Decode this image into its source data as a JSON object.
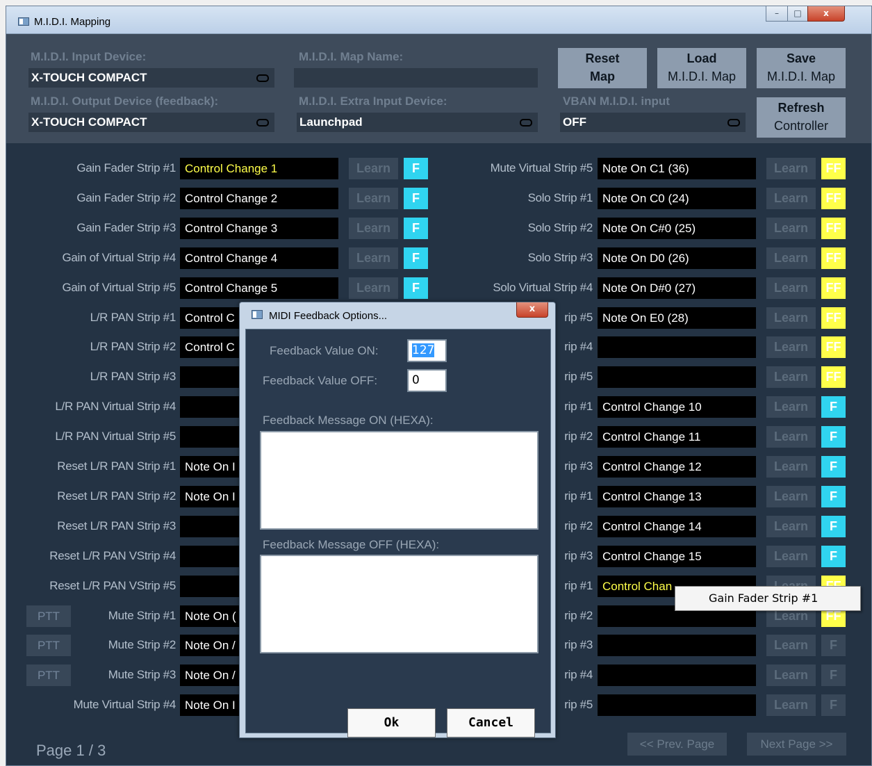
{
  "window": {
    "title": "M.I.D.I. Mapping",
    "minimize": "–",
    "maximize": "□",
    "close": "x"
  },
  "header": {
    "input_device_label": "M.I.D.I. Input Device:",
    "input_device_value": "X-TOUCH COMPACT",
    "map_name_label": "M.I.D.I. Map Name:",
    "map_name_value": "",
    "output_device_label": "M.I.D.I. Output Device (feedback):",
    "output_device_value": "X-TOUCH COMPACT",
    "extra_input_label": "M.I.D.I. Extra Input Device:",
    "extra_input_value": "Launchpad",
    "vban_label": "VBAN M.I.D.I. input",
    "vban_value": "OFF",
    "reset_map": {
      "line1": "Reset",
      "line2": "Map"
    },
    "load_map": {
      "line1": "Load",
      "line2": "M.I.D.I. Map"
    },
    "save_map": {
      "line1": "Save",
      "line2": "M.I.D.I. Map"
    },
    "refresh": {
      "line1": "Refresh",
      "line2": "Controller"
    }
  },
  "left_rows": [
    {
      "label": "Gain Fader Strip #1",
      "value": "Control Change 1",
      "highlight": true,
      "learn": "Learn",
      "f": "F",
      "f_state": "on"
    },
    {
      "label": "Gain Fader Strip #2",
      "value": "Control Change 2",
      "learn": "Learn",
      "f": "F",
      "f_state": "on"
    },
    {
      "label": "Gain Fader Strip #3",
      "value": "Control Change 3",
      "learn": "Learn",
      "f": "F",
      "f_state": "on"
    },
    {
      "label": "Gain of Virtual Strip #4",
      "value": "Control Change 4",
      "learn": "Learn",
      "f": "F",
      "f_state": "on"
    },
    {
      "label": "Gain of Virtual Strip #5",
      "value": "Control Change 5",
      "learn": "Learn",
      "f": "F",
      "f_state": "on"
    },
    {
      "label": "L/R PAN Strip #1",
      "value": "Control C"
    },
    {
      "label": "L/R PAN Strip #2",
      "value": "Control C"
    },
    {
      "label": "L/R PAN Strip #3",
      "value": ""
    },
    {
      "label": "L/R PAN Virtual Strip #4",
      "value": ""
    },
    {
      "label": "L/R PAN Virtual Strip #5",
      "value": ""
    },
    {
      "label": "Reset L/R PAN Strip #1",
      "value": "Note On I"
    },
    {
      "label": "Reset L/R PAN Strip #2",
      "value": "Note On I"
    },
    {
      "label": "Reset L/R PAN Strip #3",
      "value": ""
    },
    {
      "label": "Reset L/R PAN VStrip #4",
      "value": ""
    },
    {
      "label": "Reset L/R PAN VStrip #5",
      "value": ""
    },
    {
      "label": "Mute Strip #1",
      "value": "Note On (",
      "ptt": "PTT"
    },
    {
      "label": "Mute Strip #2",
      "value": "Note On /",
      "ptt": "PTT"
    },
    {
      "label": "Mute Strip #3",
      "value": "Note On /",
      "ptt": "PTT"
    },
    {
      "label": "Mute Virtual Strip #4",
      "value": "Note On I"
    }
  ],
  "right_rows": [
    {
      "label": "Mute Virtual Strip #5",
      "value": "Note On C1 (36)",
      "learn": "Learn",
      "f": "FF",
      "f_state": "ff"
    },
    {
      "label": "Solo Strip #1",
      "value": "Note On C0 (24)",
      "learn": "Learn",
      "f": "FF",
      "f_state": "ff"
    },
    {
      "label": "Solo Strip #2",
      "value": "Note On C#0 (25)",
      "learn": "Learn",
      "f": "FF",
      "f_state": "ff"
    },
    {
      "label": "Solo Strip #3",
      "value": "Note On D0 (26)",
      "learn": "Learn",
      "f": "FF",
      "f_state": "ff"
    },
    {
      "label": "Solo Virtual Strip #4",
      "value": "Note On D#0 (27)",
      "learn": "Learn",
      "f": "FF",
      "f_state": "ff"
    },
    {
      "label": "rip #5",
      "value": "Note On E0 (28)",
      "learn": "Learn",
      "f": "FF",
      "f_state": "ff"
    },
    {
      "label": "rip #4",
      "value": "",
      "learn": "Learn",
      "f": "FF",
      "f_state": "ff"
    },
    {
      "label": "rip #5",
      "value": "",
      "learn": "Learn",
      "f": "FF",
      "f_state": "ff"
    },
    {
      "label": "rip #1",
      "value": "Control Change 10",
      "learn": "Learn",
      "f": "F",
      "f_state": "on"
    },
    {
      "label": "rip #2",
      "value": "Control Change 11",
      "learn": "Learn",
      "f": "F",
      "f_state": "on"
    },
    {
      "label": "rip #3",
      "value": "Control Change 12",
      "learn": "Learn",
      "f": "F",
      "f_state": "on"
    },
    {
      "label": "rip #1",
      "value": "Control Change 13",
      "learn": "Learn",
      "f": "F",
      "f_state": "on"
    },
    {
      "label": "rip #2",
      "value": "Control Change 14",
      "learn": "Learn",
      "f": "F",
      "f_state": "on"
    },
    {
      "label": "rip #3",
      "value": "Control Change 15",
      "learn": "Learn",
      "f": "F",
      "f_state": "on"
    },
    {
      "label": "rip #1",
      "value": "Control Chan",
      "highlight": true,
      "learn": "Learn",
      "f": "FF",
      "f_state": "ff"
    },
    {
      "label": "rip #2",
      "value": "",
      "learn": "Learn",
      "f": "FF",
      "f_state": "ff"
    },
    {
      "label": "rip #3",
      "value": "",
      "learn": "Learn",
      "f": "F",
      "f_state": "off"
    },
    {
      "label": "rip #4",
      "value": "",
      "learn": "Learn",
      "f": "F",
      "f_state": "off"
    },
    {
      "label": "rip #5",
      "value": "",
      "learn": "Learn",
      "f": "F",
      "f_state": "off"
    }
  ],
  "footer": {
    "page": "Page 1 / 3",
    "prev": "<< Prev. Page",
    "next": "Next Page >>"
  },
  "tooltip": "Gain Fader Strip #1",
  "dialog": {
    "title": "MIDI Feedback Options...",
    "close": "x",
    "value_on_label": "Feedback Value ON:",
    "value_on": "127",
    "value_off_label": "Feedback Value OFF:",
    "value_off": "0",
    "msg_on_label": "Feedback Message ON (HEXA):",
    "msg_on": "",
    "msg_off_label": "Feedback Message OFF (HEXA):",
    "msg_off": "",
    "ok": "Ok",
    "cancel": "Cancel"
  },
  "colors": {
    "accent_cyan": "#30d4f0",
    "highlight_yellow": "#ffff4a",
    "ff_yellow": "#ffff4a"
  }
}
